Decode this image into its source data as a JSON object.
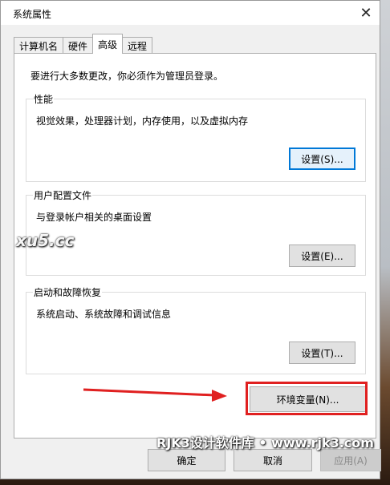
{
  "window": {
    "title": "系统属性",
    "close_symbol": "✕"
  },
  "tabs": [
    {
      "label": "计算机名",
      "active": false
    },
    {
      "label": "硬件",
      "active": false
    },
    {
      "label": "高级",
      "active": true
    },
    {
      "label": "远程",
      "active": false
    }
  ],
  "advanced": {
    "notice": "要进行大多数更改，你必须作为管理员登录。",
    "performance": {
      "title": "性能",
      "description": "视觉效果，处理器计划，内存使用，以及虚拟内存",
      "settings_button": "设置(S)..."
    },
    "user_profiles": {
      "title": "用户配置文件",
      "description": "与登录帐户相关的桌面设置",
      "settings_button": "设置(E)..."
    },
    "startup_recovery": {
      "title": "启动和故障恢复",
      "description": "系统启动、系统故障和调试信息",
      "settings_button": "设置(T)..."
    },
    "env_button": "环境变量(N)..."
  },
  "footer": {
    "ok_button": "确定",
    "cancel_button": "取消",
    "apply_button": "应用(A)"
  },
  "watermarks": {
    "site_logo": "xu5.cc",
    "caption": "RJK3设计软件库 • www.rjk3.com"
  },
  "annotation": {
    "highlight_color": "#e02020"
  }
}
